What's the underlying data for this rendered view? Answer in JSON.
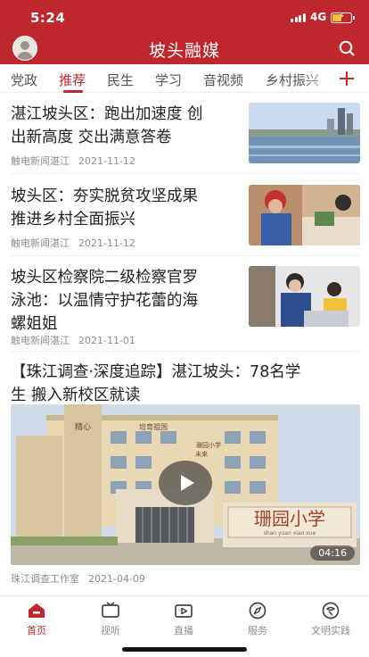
{
  "status_bar": {
    "time": "5:24",
    "network": "4G"
  },
  "header": {
    "title": "坡头融媒"
  },
  "channels": [
    {
      "label": "党政",
      "active": false
    },
    {
      "label": "推荐",
      "active": true
    },
    {
      "label": "民生",
      "active": false
    },
    {
      "label": "学习",
      "active": false
    },
    {
      "label": "音视频",
      "active": false
    },
    {
      "label": "乡村振兴",
      "active": false
    }
  ],
  "news": [
    {
      "title_line1": "湛江坡头区：跑出加速度 创",
      "title_line2": "出新高度 交出满意答卷",
      "title_line3": "",
      "source": "触电新闻湛江",
      "date": "2021-11-12"
    },
    {
      "title_line1": "坡头区：夯实脱贫攻坚成果",
      "title_line2": "推进乡村全面振兴",
      "title_line3": "",
      "source": "触电新闻湛江",
      "date": "2021-11-12"
    },
    {
      "title_line1": "坡头区检察院二级检察官罗",
      "title_line2": "泳池：以温情守护花蕾的海",
      "title_line3": "螺姐姐",
      "source": "触电新闻湛江",
      "date": "2021-11-01"
    }
  ],
  "video_news": {
    "title_line1": "【珠江调查·深度追踪】湛江坡头：78名学",
    "title_line2": "生 搬入新校区就读",
    "duration": "04:16",
    "source": "珠江调查工作室",
    "date": "2021-04-09",
    "image_text": {
      "sign_main": "珊园小学",
      "sign_pinyin": "shan  yuan  xiao  xue",
      "tower_top": "精心",
      "tower_mid": "培育祖国",
      "tower_low": "未来",
      "banner": "珊园小学"
    }
  },
  "tabbar": [
    {
      "label": "首页",
      "icon": "home-icon",
      "active": true
    },
    {
      "label": "视听",
      "icon": "tv-icon",
      "active": false
    },
    {
      "label": "直播",
      "icon": "live-icon",
      "active": false
    },
    {
      "label": "服务",
      "icon": "compass-icon",
      "active": false
    },
    {
      "label": "文明实践",
      "icon": "civilization-icon",
      "active": false
    }
  ],
  "colors": {
    "brand": "#c0272d",
    "muted": "#8d8d8d"
  }
}
